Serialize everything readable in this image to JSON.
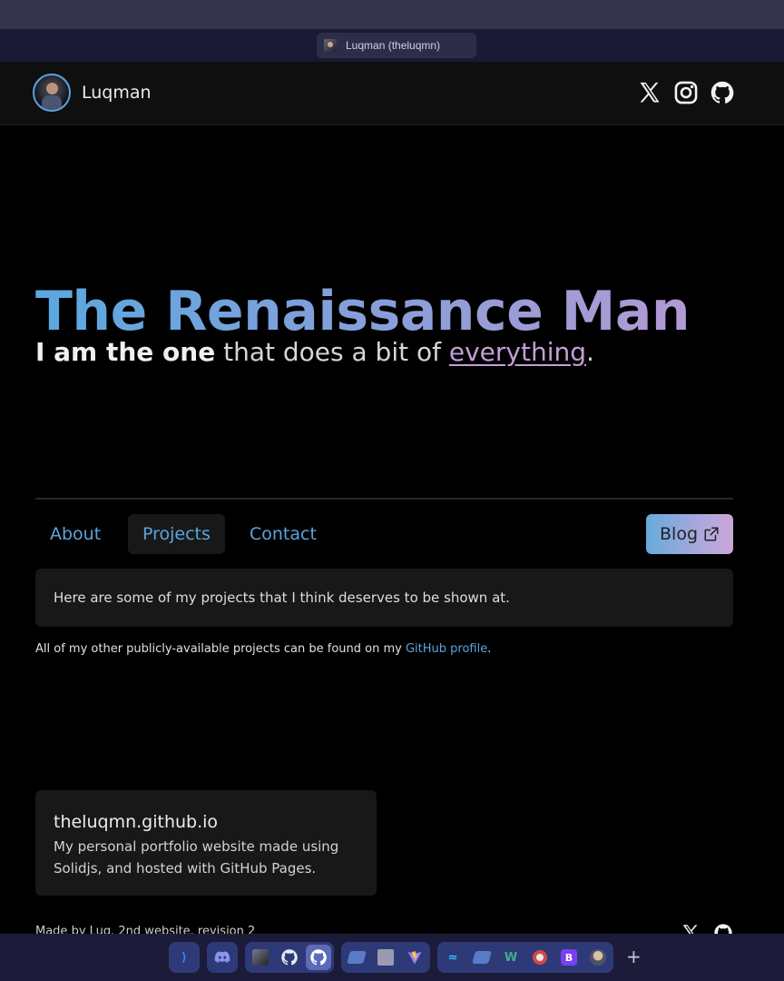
{
  "browser": {
    "tab_title": "Luqman (theluqmn)"
  },
  "header": {
    "site_name": "Luqman",
    "social_icons": [
      "x-icon",
      "instagram-icon",
      "github-icon"
    ]
  },
  "hero": {
    "title": "The Renaissance Man",
    "subtitle_bold": "I am the one",
    "subtitle_middle": " that does a bit of ",
    "subtitle_link": "everything",
    "subtitle_end": "."
  },
  "nav": {
    "tabs": [
      {
        "label": "About",
        "active": false
      },
      {
        "label": "Projects",
        "active": true
      },
      {
        "label": "Contact",
        "active": false
      }
    ],
    "blog_label": "Blog"
  },
  "projects": {
    "intro": "Here are some of my projects that I think deserves to be shown at.",
    "other_prefix": "All of my other publicly-available projects can be found on my ",
    "other_link": "GitHub profile",
    "other_suffix": ".",
    "cards": [
      {
        "title": "theluqmn.github.io",
        "description": "My personal portfolio website made using Solidjs, and hosted with GitHub Pages."
      }
    ]
  },
  "footer": {
    "text": "Made by Luq. 2nd website, revision 2"
  },
  "colors": {
    "accent": "#5aa4dc",
    "gradient_start": "#5aa8e0",
    "gradient_end": "#c39ed6",
    "background": "#000000",
    "card": "#181818"
  },
  "taskbar": {
    "apps": [
      "vscode-icon",
      "discord-icon",
      "avatar-app-icon",
      "github-icon",
      "github-desktop-icon",
      "app-icon",
      "app-icon",
      "vite-icon",
      "tailwind-icon",
      "app-icon",
      "windicss-icon",
      "opera-icon",
      "bootstrap-icon",
      "profile-icon"
    ],
    "add_label": "+"
  }
}
